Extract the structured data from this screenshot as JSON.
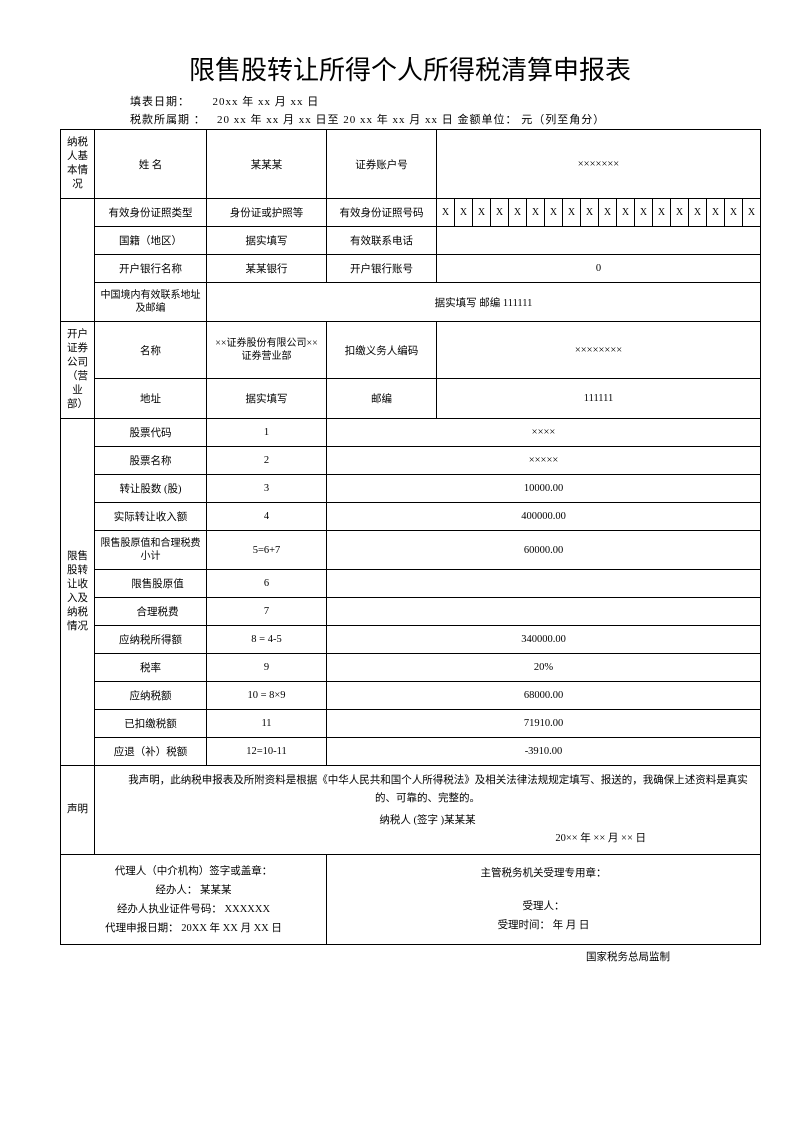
{
  "title": "限售股转让所得个人所得税清算申报表",
  "meta": {
    "fill_date_label": "填表日期：",
    "fill_date_value": "20xx   年   xx 月   xx   日",
    "period_label": "税款所属期 ：",
    "period_value": "20 xx 年 xx   月 xx   日至 20 xx 年 xx 月 xx   日   金额单位： 元（列至角分）"
  },
  "sections": {
    "taxpayer": "纳税人基本情况",
    "broker": "开户证券公司（营业部）",
    "transfer": "限售股转让收入及纳税情况",
    "declare": "声明"
  },
  "fields": {
    "name_label": "姓 名",
    "name_value": "某某某",
    "sec_account_label": "证券账户号",
    "sec_account_value": "×××××××",
    "id_type_label": "有效身份证照类型",
    "id_type_value": "身份证或护照等",
    "id_no_label": "有效身份证照号码",
    "id_cells": [
      "X",
      "X",
      "X",
      "X",
      "X",
      "X",
      "X",
      "X",
      "X",
      "X",
      "X",
      "X",
      "X",
      "X",
      "X",
      "X",
      "X",
      "X"
    ],
    "nationality_label": "国籍（地区）",
    "nationality_value": "据实填写",
    "phone_label": "有效联系电话",
    "phone_value": "",
    "bank_label": "开户银行名称",
    "bank_value": "某某银行",
    "bank_acct_label": "开户银行账号",
    "bank_acct_value": "0",
    "addr_label": "中国境内有效联系地址及邮编",
    "addr_value": "据实填写         邮编 111111",
    "broker_name_label": "名称",
    "broker_name_value": "××证券股份有限公司××证券营业部",
    "withhold_code_label": "扣缴义务人编码",
    "withhold_code_value": "××××××××",
    "broker_addr_label": "地址",
    "broker_addr_value": "据实填写",
    "broker_zip_label": "邮编",
    "broker_zip_value": "111111"
  },
  "rows": [
    {
      "label": "股票代码",
      "no": "1",
      "value": "××××"
    },
    {
      "label": "股票名称",
      "no": "2",
      "value": "×××××"
    },
    {
      "label": "转让股数 (股)",
      "no": "3",
      "value": "10000.00"
    },
    {
      "label": "实际转让收入额",
      "no": "4",
      "value": "400000.00"
    },
    {
      "label": "限售股原值和合理税费小计",
      "no": "5=6+7",
      "value": "60000.00"
    },
    {
      "label": "限售股原值",
      "no": "6",
      "value": "",
      "indent": true
    },
    {
      "label": "合理税费",
      "no": "7",
      "value": "",
      "indent": true
    },
    {
      "label": "应纳税所得额",
      "no": "8 = 4-5",
      "value": "340000.00"
    },
    {
      "label": "税率",
      "no": "9",
      "value": "20%"
    },
    {
      "label": "应纳税额",
      "no": "10 = 8×9",
      "value": "68000.00"
    },
    {
      "label": "已扣缴税额",
      "no": "11",
      "value": "71910.00"
    },
    {
      "label": "应退（补）税额",
      "no": "12=10-11",
      "value": "-3910.00"
    }
  ],
  "declaration": {
    "text": "我声明，此纳税申报表及所附资料是根据《中华人民共和国个人所得税法》及相关法律法规规定填写、报送的，我确保上述资料是真实的、可靠的、完整的。",
    "sign_label": "纳税人 (签字 )某某某",
    "sign_date": "20×× 年 ×× 月 ×× 日"
  },
  "agent": {
    "line1": "代理人（中介机构）签字或盖章：",
    "line2": "经办人： 某某某",
    "line3": "经办人执业证件号码：   XXXXXX",
    "line4": "代理申报日期：   20XX 年 XX 月 XX  日"
  },
  "authority": {
    "line1": "主管税务机关受理专用章：",
    "line2": "受理人：",
    "line3": "受理时间：     年   月   日"
  },
  "footer": "国家税务总局监制"
}
